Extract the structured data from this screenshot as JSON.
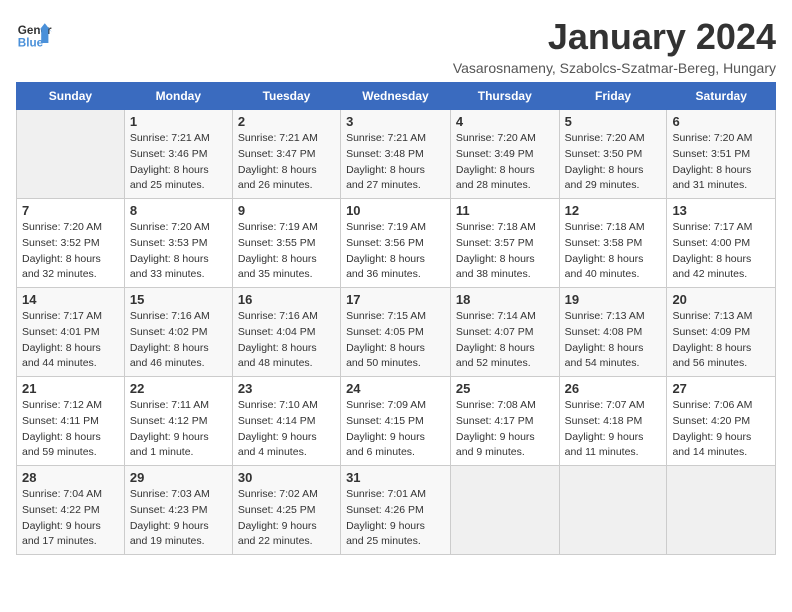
{
  "logo": {
    "line1": "General",
    "line2": "Blue"
  },
  "title": "January 2024",
  "subtitle": "Vasarosnameny, Szabolcs-Szatmar-Bereg, Hungary",
  "days_of_week": [
    "Sunday",
    "Monday",
    "Tuesday",
    "Wednesday",
    "Thursday",
    "Friday",
    "Saturday"
  ],
  "weeks": [
    [
      {
        "day": "",
        "sunrise": "",
        "sunset": "",
        "daylight": ""
      },
      {
        "day": "1",
        "sunrise": "7:21 AM",
        "sunset": "3:46 PM",
        "daylight": "8 hours and 25 minutes."
      },
      {
        "day": "2",
        "sunrise": "7:21 AM",
        "sunset": "3:47 PM",
        "daylight": "8 hours and 26 minutes."
      },
      {
        "day": "3",
        "sunrise": "7:21 AM",
        "sunset": "3:48 PM",
        "daylight": "8 hours and 27 minutes."
      },
      {
        "day": "4",
        "sunrise": "7:20 AM",
        "sunset": "3:49 PM",
        "daylight": "8 hours and 28 minutes."
      },
      {
        "day": "5",
        "sunrise": "7:20 AM",
        "sunset": "3:50 PM",
        "daylight": "8 hours and 29 minutes."
      },
      {
        "day": "6",
        "sunrise": "7:20 AM",
        "sunset": "3:51 PM",
        "daylight": "8 hours and 31 minutes."
      }
    ],
    [
      {
        "day": "7",
        "sunrise": "7:20 AM",
        "sunset": "3:52 PM",
        "daylight": "8 hours and 32 minutes."
      },
      {
        "day": "8",
        "sunrise": "7:20 AM",
        "sunset": "3:53 PM",
        "daylight": "8 hours and 33 minutes."
      },
      {
        "day": "9",
        "sunrise": "7:19 AM",
        "sunset": "3:55 PM",
        "daylight": "8 hours and 35 minutes."
      },
      {
        "day": "10",
        "sunrise": "7:19 AM",
        "sunset": "3:56 PM",
        "daylight": "8 hours and 36 minutes."
      },
      {
        "day": "11",
        "sunrise": "7:18 AM",
        "sunset": "3:57 PM",
        "daylight": "8 hours and 38 minutes."
      },
      {
        "day": "12",
        "sunrise": "7:18 AM",
        "sunset": "3:58 PM",
        "daylight": "8 hours and 40 minutes."
      },
      {
        "day": "13",
        "sunrise": "7:17 AM",
        "sunset": "4:00 PM",
        "daylight": "8 hours and 42 minutes."
      }
    ],
    [
      {
        "day": "14",
        "sunrise": "7:17 AM",
        "sunset": "4:01 PM",
        "daylight": "8 hours and 44 minutes."
      },
      {
        "day": "15",
        "sunrise": "7:16 AM",
        "sunset": "4:02 PM",
        "daylight": "8 hours and 46 minutes."
      },
      {
        "day": "16",
        "sunrise": "7:16 AM",
        "sunset": "4:04 PM",
        "daylight": "8 hours and 48 minutes."
      },
      {
        "day": "17",
        "sunrise": "7:15 AM",
        "sunset": "4:05 PM",
        "daylight": "8 hours and 50 minutes."
      },
      {
        "day": "18",
        "sunrise": "7:14 AM",
        "sunset": "4:07 PM",
        "daylight": "8 hours and 52 minutes."
      },
      {
        "day": "19",
        "sunrise": "7:13 AM",
        "sunset": "4:08 PM",
        "daylight": "8 hours and 54 minutes."
      },
      {
        "day": "20",
        "sunrise": "7:13 AM",
        "sunset": "4:09 PM",
        "daylight": "8 hours and 56 minutes."
      }
    ],
    [
      {
        "day": "21",
        "sunrise": "7:12 AM",
        "sunset": "4:11 PM",
        "daylight": "8 hours and 59 minutes."
      },
      {
        "day": "22",
        "sunrise": "7:11 AM",
        "sunset": "4:12 PM",
        "daylight": "9 hours and 1 minute."
      },
      {
        "day": "23",
        "sunrise": "7:10 AM",
        "sunset": "4:14 PM",
        "daylight": "9 hours and 4 minutes."
      },
      {
        "day": "24",
        "sunrise": "7:09 AM",
        "sunset": "4:15 PM",
        "daylight": "9 hours and 6 minutes."
      },
      {
        "day": "25",
        "sunrise": "7:08 AM",
        "sunset": "4:17 PM",
        "daylight": "9 hours and 9 minutes."
      },
      {
        "day": "26",
        "sunrise": "7:07 AM",
        "sunset": "4:18 PM",
        "daylight": "9 hours and 11 minutes."
      },
      {
        "day": "27",
        "sunrise": "7:06 AM",
        "sunset": "4:20 PM",
        "daylight": "9 hours and 14 minutes."
      }
    ],
    [
      {
        "day": "28",
        "sunrise": "7:04 AM",
        "sunset": "4:22 PM",
        "daylight": "9 hours and 17 minutes."
      },
      {
        "day": "29",
        "sunrise": "7:03 AM",
        "sunset": "4:23 PM",
        "daylight": "9 hours and 19 minutes."
      },
      {
        "day": "30",
        "sunrise": "7:02 AM",
        "sunset": "4:25 PM",
        "daylight": "9 hours and 22 minutes."
      },
      {
        "day": "31",
        "sunrise": "7:01 AM",
        "sunset": "4:26 PM",
        "daylight": "9 hours and 25 minutes."
      },
      {
        "day": "",
        "sunrise": "",
        "sunset": "",
        "daylight": ""
      },
      {
        "day": "",
        "sunrise": "",
        "sunset": "",
        "daylight": ""
      },
      {
        "day": "",
        "sunrise": "",
        "sunset": "",
        "daylight": ""
      }
    ]
  ]
}
